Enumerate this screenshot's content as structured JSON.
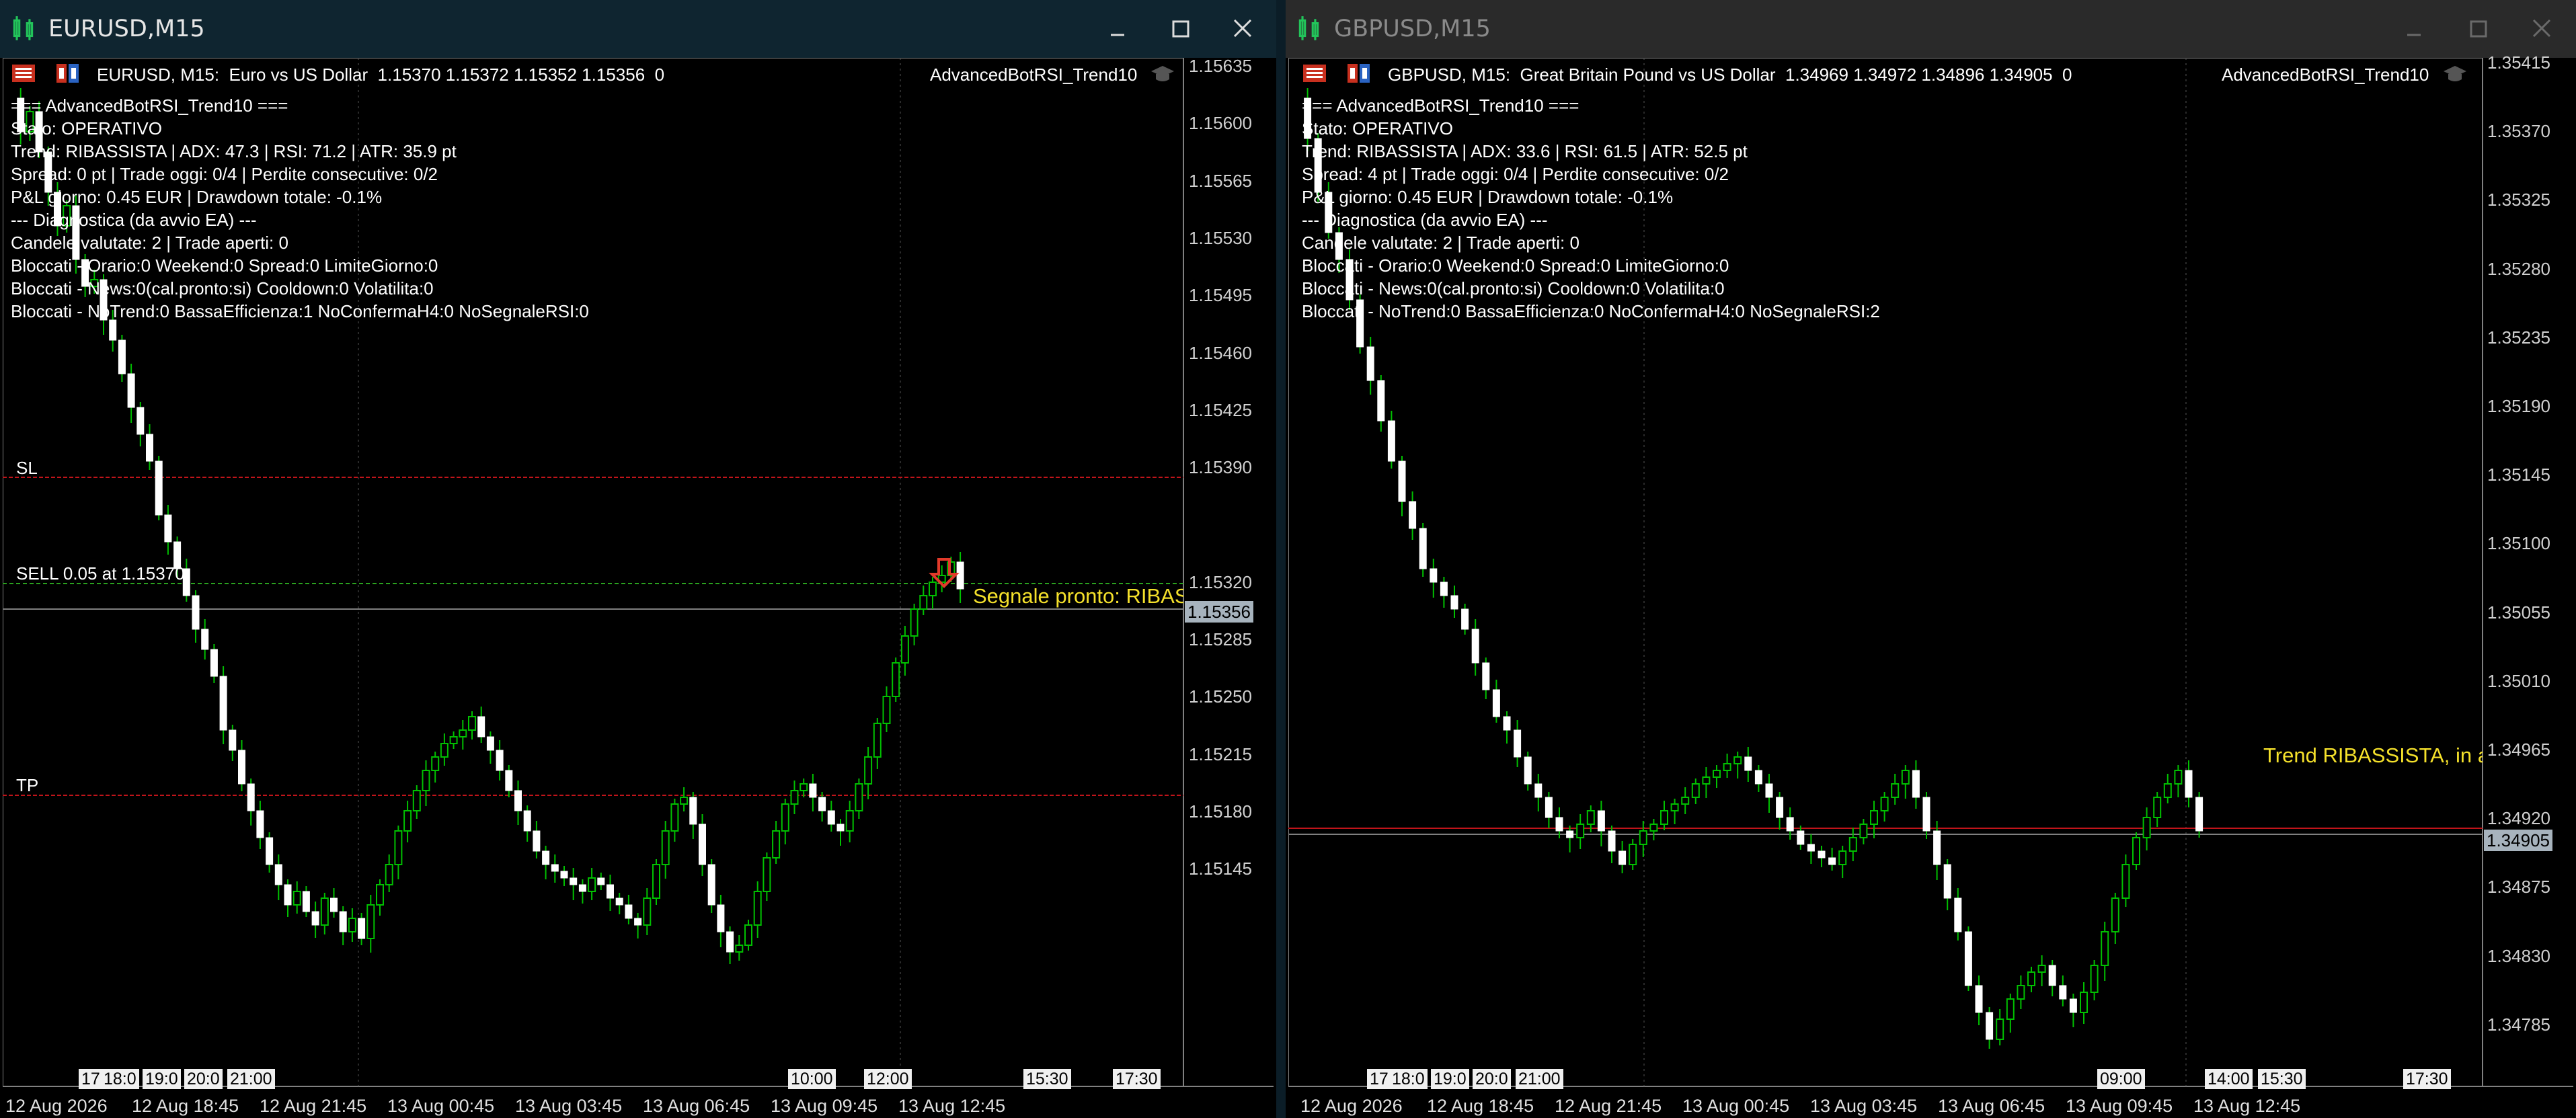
{
  "left": {
    "title": "EURUSD,M15",
    "symbol_line": "EURUSD, M15:  Euro vs US Dollar  1.15370 1.15372 1.15352 1.15356  0",
    "ea_name": "AdvancedBotRSI_Trend10",
    "info_lines": [
      "=== AdvancedBotRSI_Trend10 ===",
      "Stato: OPERATIVO",
      "Trend: RIBASSISTA | ADX: 47.3 | RSI: 71.2 | ATR: 35.9 pt",
      "Spread: 0 pt | Trade oggi: 0/4 | Perdite consecutive: 0/2",
      "P&L giorno: 0.45 EUR | Drawdown totale: -0.1%",
      "--- Diagnostica (da avvio EA) ---",
      "Candele valutate: 2 | Trade aperti: 0",
      "Bloccati - Orario:0 Weekend:0 Spread:0 LimiteGiorno:0",
      "Bloccati - News:0(cal.pronto:si) Cooldown:0 Volatilita:0",
      "Bloccati - NoTrend:0 BassaEfficienza:1 NoConfermaH4:0 NoSegnaleRSI:0"
    ],
    "sl_label": "SL",
    "sell_label": "SELL 0.05 at 1.15370",
    "tp_label": "TP",
    "signal_text": "Segnale pronto: RIBASSISTA",
    "price_scale": [
      "1.15635",
      "1.15600",
      "1.15565",
      "1.15530",
      "1.15495",
      "1.15460",
      "1.15425",
      "1.15390",
      "1.15320",
      "1.15285",
      "1.15250",
      "1.15215",
      "1.15180",
      "1.15145"
    ],
    "current_price": "1.15356",
    "time_labels": [
      "17",
      "18:0",
      "19:0",
      "20:0",
      "21:00"
    ],
    "time_badges": [
      "10:00",
      "12:00"
    ],
    "time_right": [
      "15:30",
      "17:30"
    ],
    "date_labels": [
      "12 Aug 2026",
      "12 Aug 18:45",
      "12 Aug 21:45",
      "13 Aug 00:45",
      "13 Aug 03:45",
      "13 Aug 06:45",
      "13 Aug 09:45",
      "13 Aug 12:45"
    ]
  },
  "right": {
    "title": "GBPUSD,M15",
    "symbol_line": "GBPUSD, M15:  Great Britain Pound vs US Dollar  1.34969 1.34972 1.34896 1.34905  0",
    "ea_name": "AdvancedBotRSI_Trend10",
    "info_lines": [
      "=== AdvancedBotRSI_Trend10 ===",
      "Stato: OPERATIVO",
      "Trend: RIBASSISTA | ADX: 33.6 | RSI: 61.5 | ATR: 52.5 pt",
      "Spread: 4 pt | Trade oggi: 0/4 | Perdite consecutive: 0/2",
      "P&L giorno: 0.45 EUR | Drawdown totale: -0.1%",
      "--- Diagnostica (da avvio EA) ---",
      "Candele valutate: 2 | Trade aperti: 0",
      "Bloccati - Orario:0 Weekend:0 Spread:0 LimiteGiorno:0",
      "Bloccati - News:0(cal.pronto:si) Cooldown:0 Volatilita:0",
      "Bloccati - NoTrend:0 BassaEfficienza:0 NoConfermaH4:0 NoSegnaleRSI:2"
    ],
    "signal_text": "Trend RIBASSISTA, in attesa",
    "price_scale": [
      "1.35415",
      "1.35370",
      "1.35325",
      "1.35280",
      "1.35235",
      "1.35190",
      "1.35145",
      "1.35100",
      "1.35055",
      "1.35010",
      "1.34965",
      "1.34920",
      "1.34875",
      "1.34830",
      "1.34785"
    ],
    "current_price": "1.34905",
    "time_labels": [
      "17",
      "18:0",
      "19:0",
      "20:0",
      "21:00"
    ],
    "time_badges": [
      "09:00",
      "14:00",
      "15:30"
    ],
    "time_right": [
      "17:30"
    ],
    "date_labels": [
      "12 Aug 2026",
      "12 Aug 18:45",
      "12 Aug 21:45",
      "13 Aug 00:45",
      "13 Aug 03:45",
      "13 Aug 06:45",
      "13 Aug 09:45",
      "13 Aug 12:45"
    ]
  },
  "colors": {
    "bull_body": "#000000",
    "bull_wick": "#00c000",
    "bear_body": "#ffffff",
    "sl_line": "#c0141a",
    "tp_line": "#c0141a",
    "signal": "#f5e12b",
    "titlebar_active": "#0f2530"
  }
}
